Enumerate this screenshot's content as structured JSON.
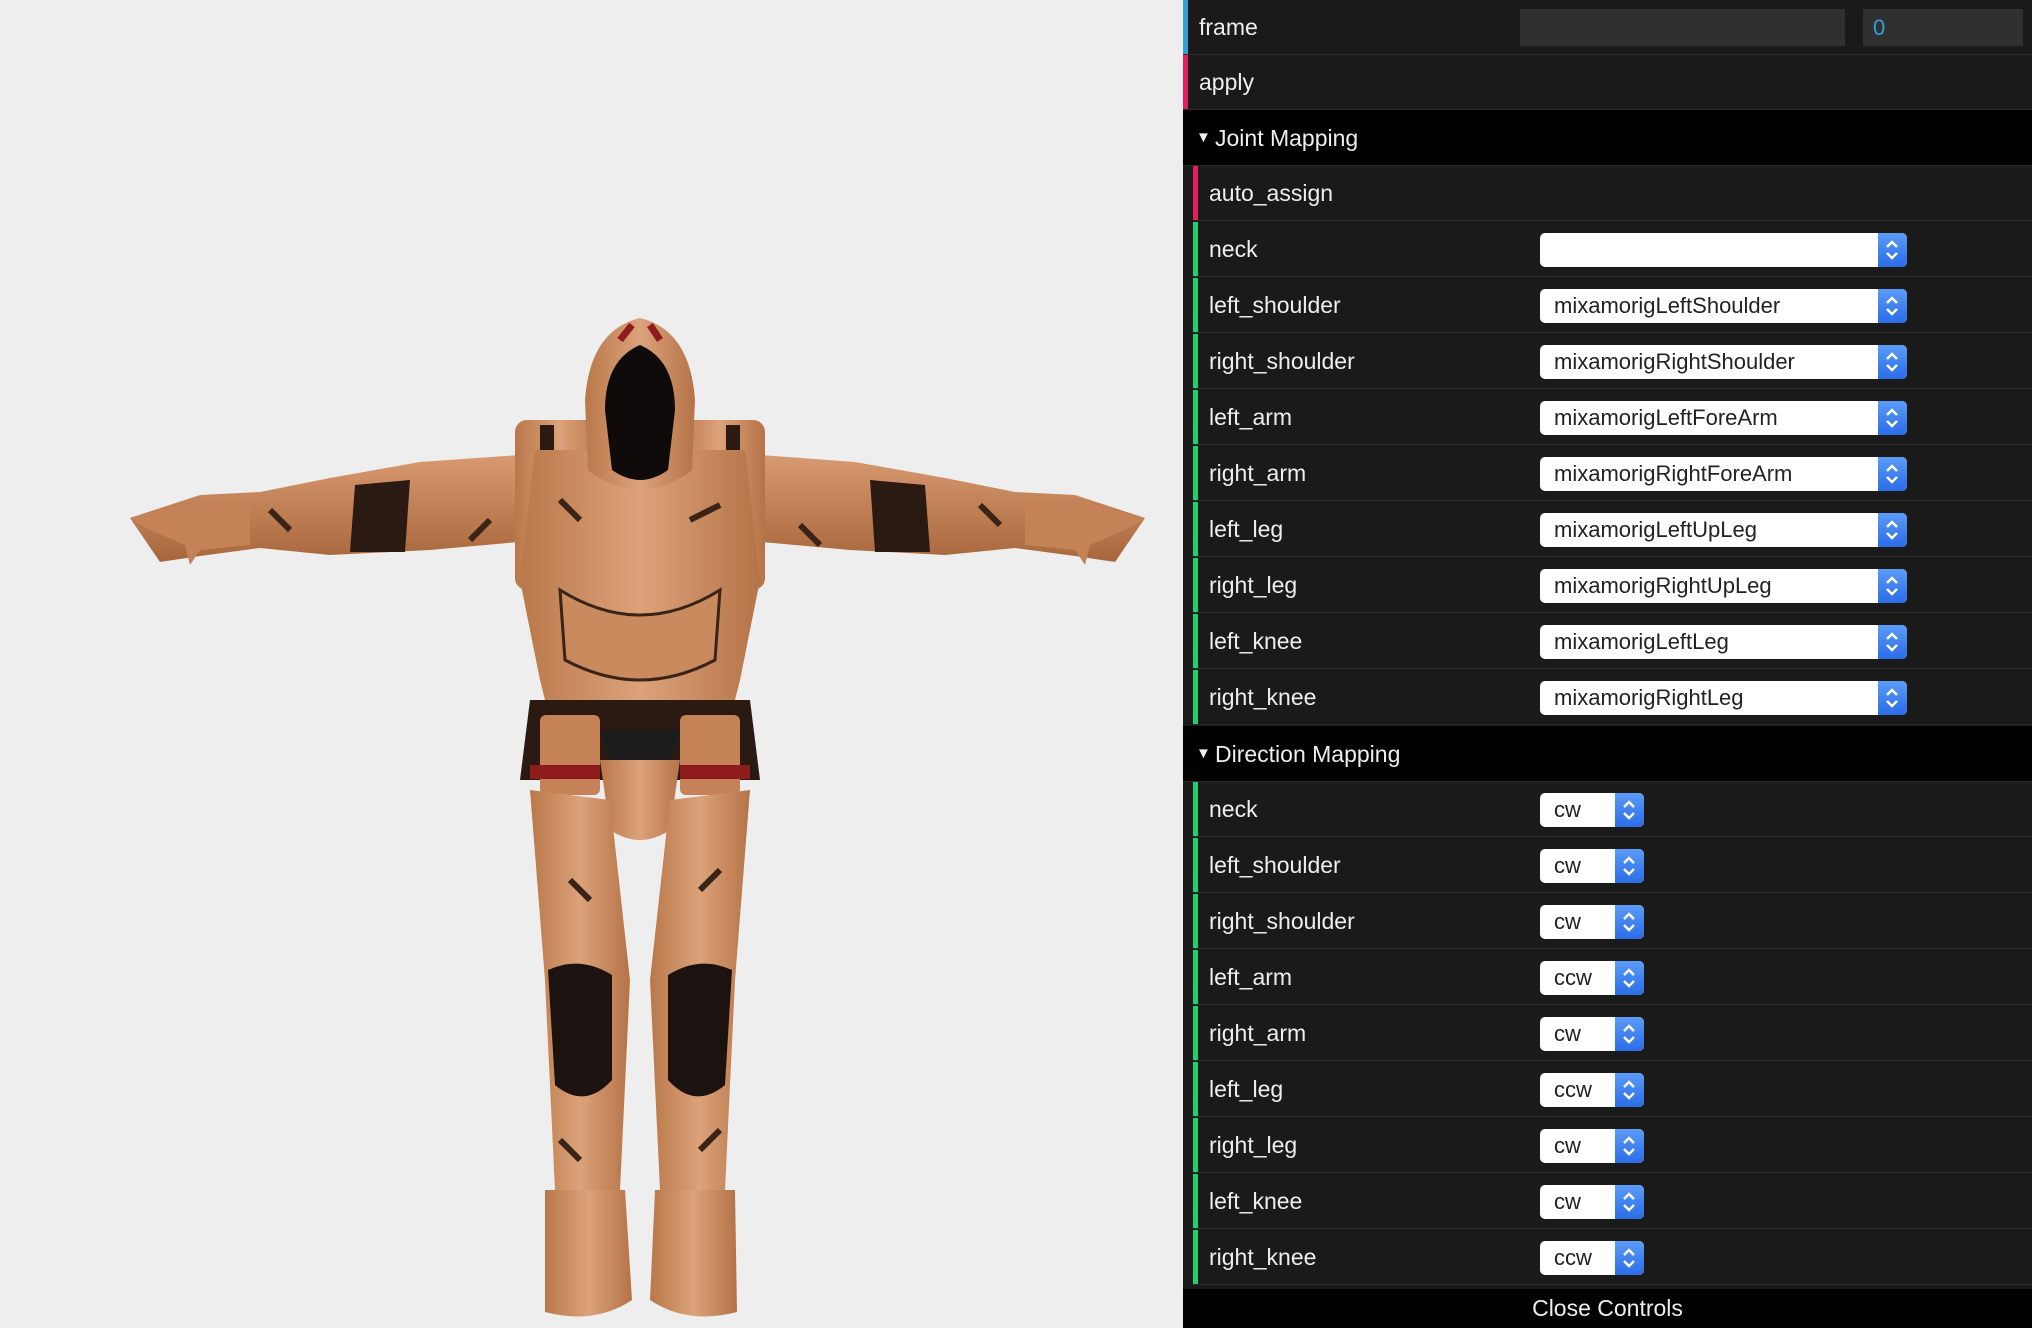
{
  "gui": {
    "frame": {
      "label": "frame",
      "value": "0"
    },
    "apply": {
      "label": "apply"
    },
    "joint_mapping": {
      "title": "Joint Mapping",
      "auto_assign_label": "auto_assign",
      "rows": [
        {
          "label": "neck",
          "value": ""
        },
        {
          "label": "left_shoulder",
          "value": "mixamorigLeftShoulder"
        },
        {
          "label": "right_shoulder",
          "value": "mixamorigRightShoulder"
        },
        {
          "label": "left_arm",
          "value": "mixamorigLeftForeArm"
        },
        {
          "label": "right_arm",
          "value": "mixamorigRightForeArm"
        },
        {
          "label": "left_leg",
          "value": "mixamorigLeftUpLeg"
        },
        {
          "label": "right_leg",
          "value": "mixamorigRightUpLeg"
        },
        {
          "label": "left_knee",
          "value": "mixamorigLeftLeg"
        },
        {
          "label": "right_knee",
          "value": "mixamorigRightLeg"
        }
      ]
    },
    "direction_mapping": {
      "title": "Direction Mapping",
      "rows": [
        {
          "label": "neck",
          "value": "cw"
        },
        {
          "label": "left_shoulder",
          "value": "cw"
        },
        {
          "label": "right_shoulder",
          "value": "cw"
        },
        {
          "label": "left_arm",
          "value": "ccw"
        },
        {
          "label": "right_arm",
          "value": "cw"
        },
        {
          "label": "left_leg",
          "value": "ccw"
        },
        {
          "label": "right_leg",
          "value": "cw"
        },
        {
          "label": "left_knee",
          "value": "cw"
        },
        {
          "label": "right_knee",
          "value": "ccw"
        }
      ]
    },
    "close_controls": "Close Controls"
  },
  "colors": {
    "number_bar": "#2fa1d6",
    "function_bar": "#e61d5f",
    "option_bar": "#1ed36f",
    "panel_bg": "#1a1a1a",
    "folder_bg": "#000000",
    "viewport_bg": "#eeeeee"
  },
  "icons": [
    "triangle-down-icon",
    "select-arrows-icon"
  ]
}
